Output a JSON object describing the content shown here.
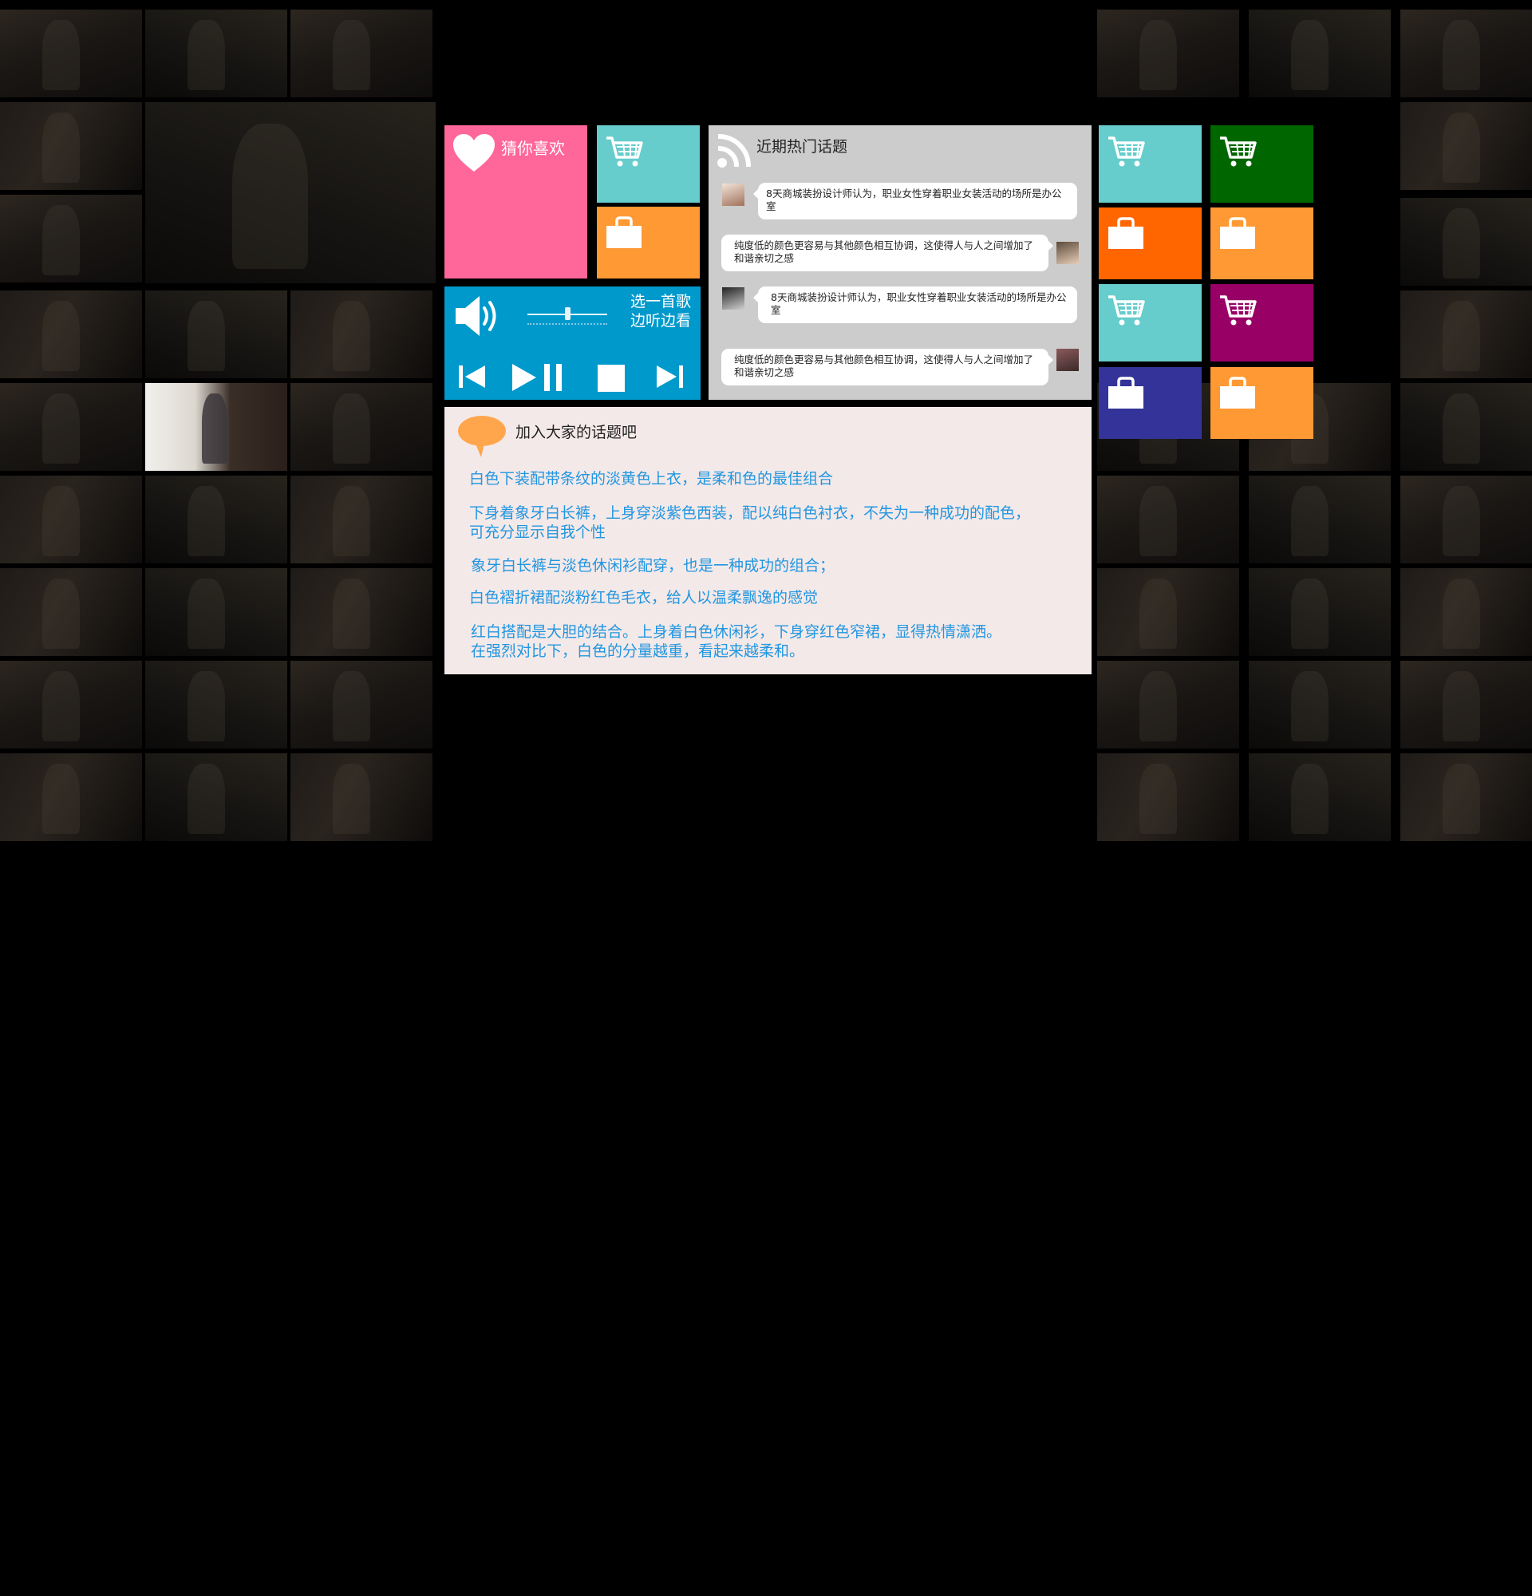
{
  "guess": {
    "label": "猜你喜欢",
    "color": "#ff6699"
  },
  "music": {
    "label_line1": "选一首歌",
    "label_line2": "边听边看",
    "color": "#0099cc",
    "volume_level": 0.5,
    "controls": [
      "previous-icon",
      "play-pause-icon",
      "stop-icon",
      "next-icon"
    ]
  },
  "hot_topics": {
    "title": "近期热门话题",
    "color": "#cccccc",
    "items": [
      {
        "text": "8天商城装扮设计师认为，职业女性穿着职业女装活动的场所是办公室",
        "side": "left"
      },
      {
        "text": "纯度低的颜色更容易与其他颜色相互协调，这使得人与人之间增加了和谐亲切之感",
        "side": "right"
      },
      {
        "text": "8天商城装扮设计师认为，职业女性穿着职业女装活动的场所是办公室",
        "side": "left"
      },
      {
        "text": "纯度低的颜色更容易与其他颜色相互协调，这使得人与人之间增加了和谐亲切之感",
        "side": "right"
      }
    ]
  },
  "join_topics": {
    "title": "加入大家的话题吧",
    "lines": [
      "白色下装配带条纹的淡黄色上衣，是柔和色的最佳组合",
      "下身着象牙白长裤，上身穿淡紫色西装，配以纯白色衬衣，不失为一种成功的配色，",
      "可充分显示自我个性",
      "象牙白长裤与淡色休闲衫配穿，也是一种成功的组合；",
      "白色褶折裙配淡粉红色毛衣，给人以温柔飘逸的感觉",
      "红白搭配是大胆的结合。上身着白色休闲衫，下身穿红色窄裙，显得热情潇洒。",
      "在强烈对比下，白色的分量越重，看起来越柔和。"
    ],
    "text_color": "#2196e0"
  },
  "shop_tiles": {
    "top_center": [
      {
        "type": "cart",
        "color": "#66cccc"
      },
      {
        "type": "bag",
        "color": "#ff9933"
      }
    ],
    "right_grid": [
      {
        "type": "cart",
        "color": "#66cccc"
      },
      {
        "type": "cart",
        "color": "#006600"
      },
      {
        "type": "bag",
        "color": "#ff6600"
      },
      {
        "type": "bag",
        "color": "#ff9933"
      },
      {
        "type": "cart",
        "color": "#66cccc"
      },
      {
        "type": "cart",
        "color": "#990066"
      },
      {
        "type": "bag",
        "color": "#333399"
      },
      {
        "type": "bag",
        "color": "#ff9933"
      }
    ]
  }
}
